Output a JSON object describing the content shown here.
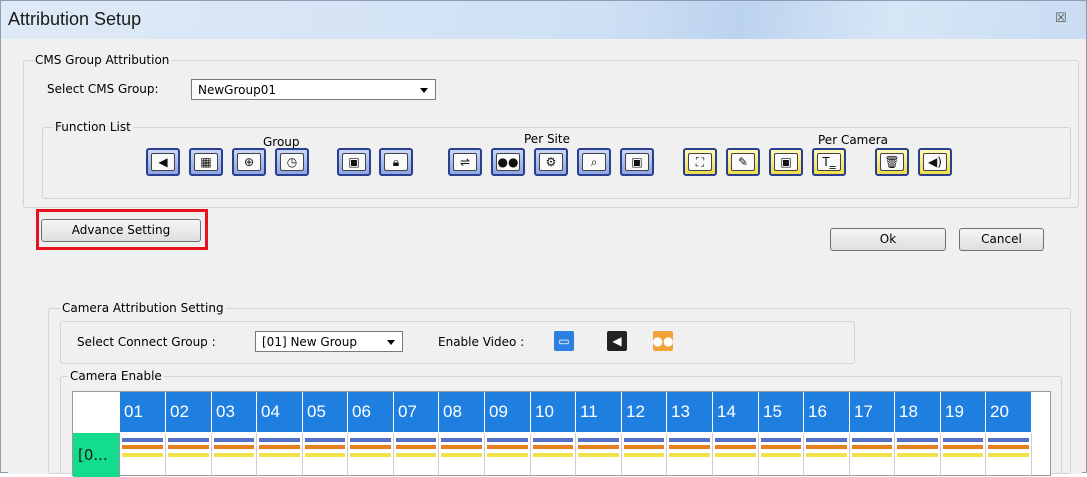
{
  "window": {
    "title": "Attribution Setup",
    "close_glyph": "☒"
  },
  "cms_group": {
    "legend": "CMS Group Attribution",
    "select_label": "Select CMS Group:",
    "selected": "NewGroup01"
  },
  "function_list": {
    "legend": "Function List",
    "group_label": "Group",
    "per_site_label": "Per Site",
    "per_camera_label": "Per Camera",
    "group_icons": [
      "left-arrow-icon",
      "film-grid-icon",
      "globe-icon",
      "clock-icon",
      "image-icon",
      "lock-icon"
    ],
    "site_icons": [
      "plug-icon",
      "camera-icon",
      "gear-icon",
      "search-icon",
      "image-export-icon"
    ],
    "camera_icons": [
      "frame-icon",
      "edit-icon",
      "image-settings-icon",
      "text-bar-icon",
      "trash-icon",
      "speaker-icon"
    ]
  },
  "buttons": {
    "advance": "Advance Setting",
    "ok": "Ok",
    "cancel": "Cancel"
  },
  "camera_attr": {
    "legend": "Camera Attribution Setting",
    "connect_label": "Select Connect Group :",
    "connect_selected": "[01] New Group",
    "enable_video_label": "Enable Video :",
    "enable_icons": [
      "monitor-icon",
      "left-arrow-icon",
      "camera-icon"
    ]
  },
  "camera_enable": {
    "legend": "Camera Enable",
    "columns": [
      "01",
      "02",
      "03",
      "04",
      "05",
      "06",
      "07",
      "08",
      "09",
      "10",
      "11",
      "12",
      "13",
      "14",
      "15",
      "16",
      "17",
      "18",
      "19",
      "20"
    ],
    "row_label": "[0..."
  },
  "colors": {
    "highlight": "#e3121c",
    "header_blue": "#1f7fe0",
    "row_green": "#14dc8f",
    "bar_blue": "#5570c8",
    "bar_orange": "#e87f1e",
    "bar_yellow": "#f2e34c"
  }
}
